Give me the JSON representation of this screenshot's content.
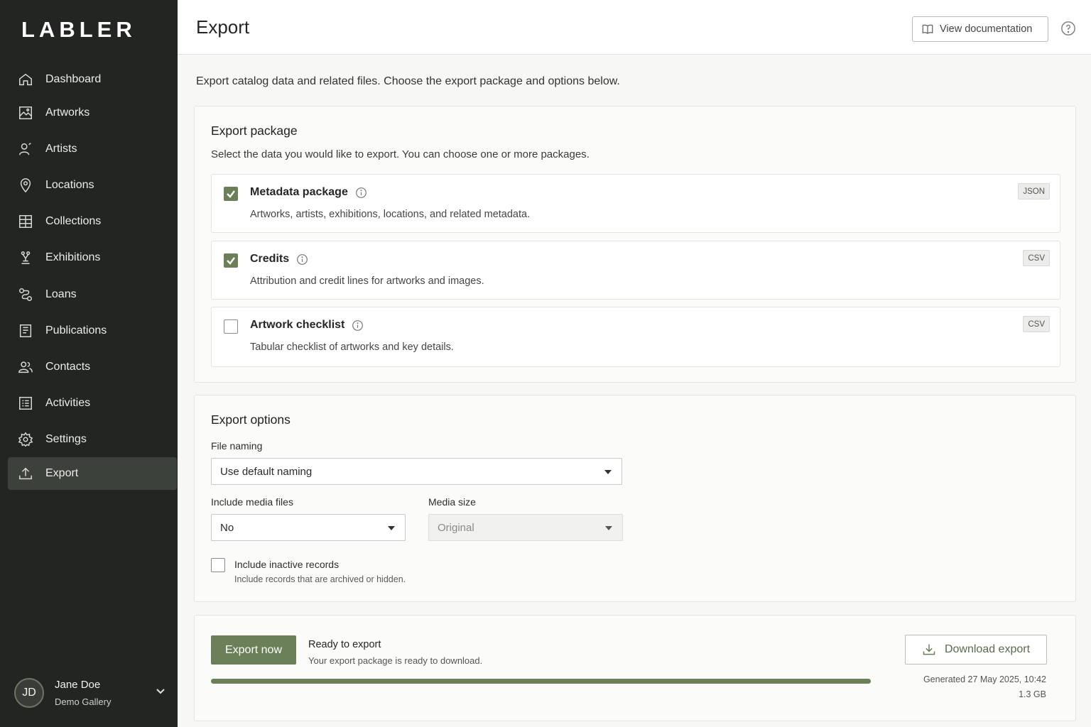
{
  "app": {
    "brand": "LABLER"
  },
  "sidebar": {
    "items": [
      {
        "label": "Dashboard",
        "icon": "home-icon"
      },
      {
        "label": "Artworks",
        "icon": "image-icon"
      },
      {
        "label": "Artists",
        "icon": "person-icon"
      },
      {
        "label": "Locations",
        "icon": "map-pin-icon"
      },
      {
        "label": "Collections",
        "icon": "grid-icon"
      },
      {
        "label": "Exhibitions",
        "icon": "sculpture-icon"
      },
      {
        "label": "Loans",
        "icon": "exchange-icon"
      },
      {
        "label": "Publications",
        "icon": "book-icon"
      },
      {
        "label": "Contacts",
        "icon": "people-icon"
      },
      {
        "label": "Activities",
        "icon": "list-icon"
      },
      {
        "label": "Settings",
        "icon": "gear-icon"
      },
      {
        "label": "Export",
        "icon": "upload-icon",
        "active": true
      }
    ],
    "user": {
      "initials": "JD",
      "name": "Jane Doe",
      "org": "Demo Gallery"
    }
  },
  "header": {
    "title": "Export",
    "doc_button": "View documentation"
  },
  "intro": "Export catalog data and related files. Choose the export package and options below.",
  "package": {
    "title": "Export package",
    "subtitle": "Select the data you would like to export. You can choose one or more packages.",
    "items": [
      {
        "title": "Metadata package",
        "desc": "Artworks, artists, exhibitions, locations, and related metadata.",
        "format": "JSON",
        "checked": true
      },
      {
        "title": "Credits",
        "desc": "Attribution and credit lines for artworks and images.",
        "format": "CSV",
        "checked": true
      },
      {
        "title": "Artwork checklist",
        "desc": "Tabular checklist of artworks and key details.",
        "format": "CSV",
        "checked": false
      }
    ]
  },
  "options": {
    "title": "Export options",
    "file_naming_label": "File naming",
    "file_naming_value": "Use default naming",
    "media_label": "Include media files",
    "media_value": "No",
    "media_size_label": "Media size",
    "media_size_value": "Original",
    "inactive_label": "Include inactive records",
    "inactive_desc": "Include records that are archived or hidden.",
    "inactive_checked": false
  },
  "export": {
    "button": "Export now",
    "status_title": "Ready to export",
    "status_sub": "Your export package is ready to download.",
    "progress_percent": 100,
    "download_button": "Download export",
    "generated": "Generated 27 May 2025, 10:42",
    "size": "1.3 GB"
  },
  "colors": {
    "accent": "#6b7f58",
    "sidebar": "#232523",
    "sidebar_active": "#3d413b"
  }
}
